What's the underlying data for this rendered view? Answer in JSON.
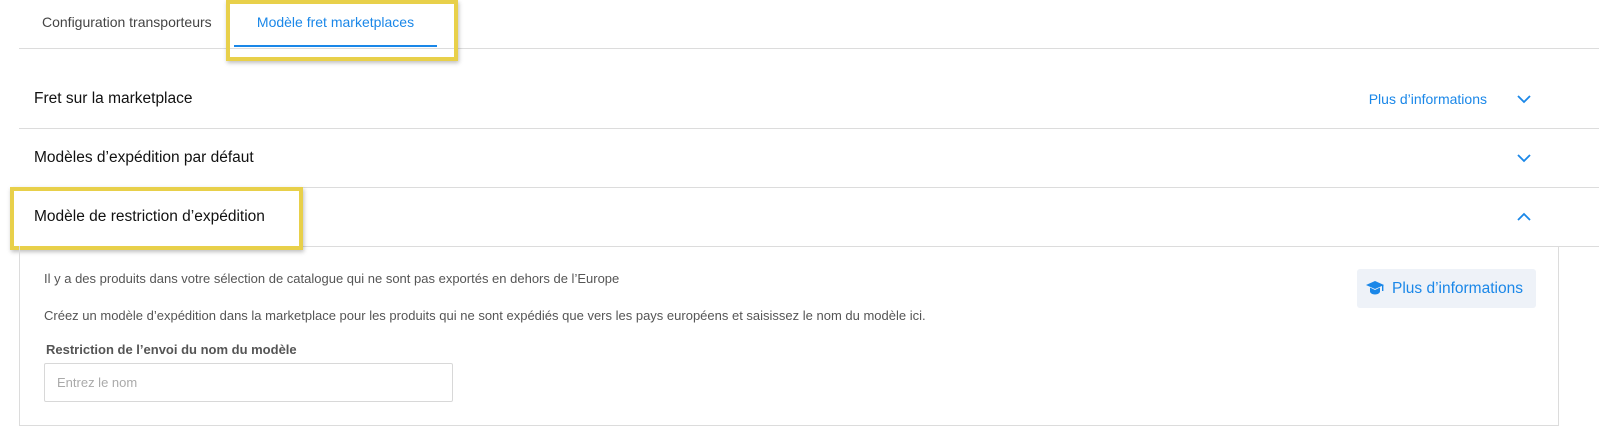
{
  "tabs": [
    {
      "label": "Configuration transporteurs",
      "active": false
    },
    {
      "label": "Modèle fret marketplaces",
      "active": true
    }
  ],
  "sections": [
    {
      "title": "Fret sur la marketplace",
      "link": "Plus d’informations",
      "expanded": false
    },
    {
      "title": "Modèles d’expédition par défaut",
      "expanded": false
    },
    {
      "title": "Modèle de restriction d’expédition",
      "expanded": true
    }
  ],
  "panel": {
    "info_line1": "Il y a des produits dans votre sélection de catalogue qui ne sont pas exportés en dehors de l’Europe",
    "info_line2": "Créez un modèle d’expédition dans la marketplace pour les produits qui ne sont expédiés que vers les pays européens et saisissez le nom du modèle ici.",
    "field_label": "Restriction de l’envoi du nom du modèle",
    "input_value": "",
    "input_placeholder": "Entrez le nom",
    "more_info_button": "Plus d’informations",
    "more_info_icon": "graduation-cap-icon"
  },
  "colors": {
    "accent": "#1a87e8",
    "highlight": "#e8d04a",
    "border": "#dcdcdc",
    "button_bg": "#eef2f8"
  }
}
